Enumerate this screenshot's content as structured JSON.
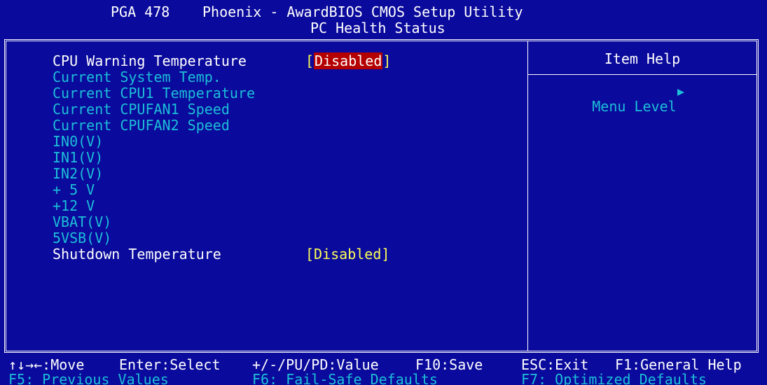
{
  "header": {
    "board": "PGA 478",
    "title": "Phoenix - AwardBIOS CMOS Setup Utility",
    "subtitle": "PC Health Status"
  },
  "items": [
    {
      "label": "CPU Warning Temperature",
      "value": "Disabled",
      "selected": true,
      "enabled": true
    },
    {
      "label": "Current System Temp.",
      "enabled": false
    },
    {
      "label": "Current CPU1 Temperature",
      "enabled": false
    },
    {
      "label": "Current CPUFAN1 Speed",
      "enabled": false
    },
    {
      "label": "Current CPUFAN2 Speed",
      "enabled": false
    },
    {
      "label": "IN0(V)",
      "enabled": false
    },
    {
      "label": "IN1(V)",
      "enabled": false
    },
    {
      "label": "IN2(V)",
      "enabled": false
    },
    {
      "label": "+ 5 V",
      "enabled": false
    },
    {
      "label": "+12 V",
      "enabled": false
    },
    {
      "label": "VBAT(V)",
      "enabled": false
    },
    {
      "label": "5VSB(V)",
      "enabled": false
    },
    {
      "label": "Shutdown Temperature",
      "value": "Disabled",
      "selected": false,
      "enabled": true
    }
  ],
  "help": {
    "title": "Item Help",
    "menu_level": "Menu Level",
    "arrow_icon": "right-triangle-icon"
  },
  "footer": {
    "move": "↑↓→←:Move",
    "select": "Enter:Select",
    "value": "+/-/PU/PD:Value",
    "save": "F10:Save",
    "exit": "ESC:Exit",
    "help": "F1:General Help",
    "prev": "F5: Previous Values",
    "failsafe": "F6: Fail-Safe Defaults",
    "optimized": "F7: Optimized Defaults"
  },
  "colors": {
    "background": "#0a0a9c",
    "text": "#ffffff",
    "disabled_text": "#1cbfd8",
    "value_text": "#ffff55",
    "selection": "#b40000"
  }
}
